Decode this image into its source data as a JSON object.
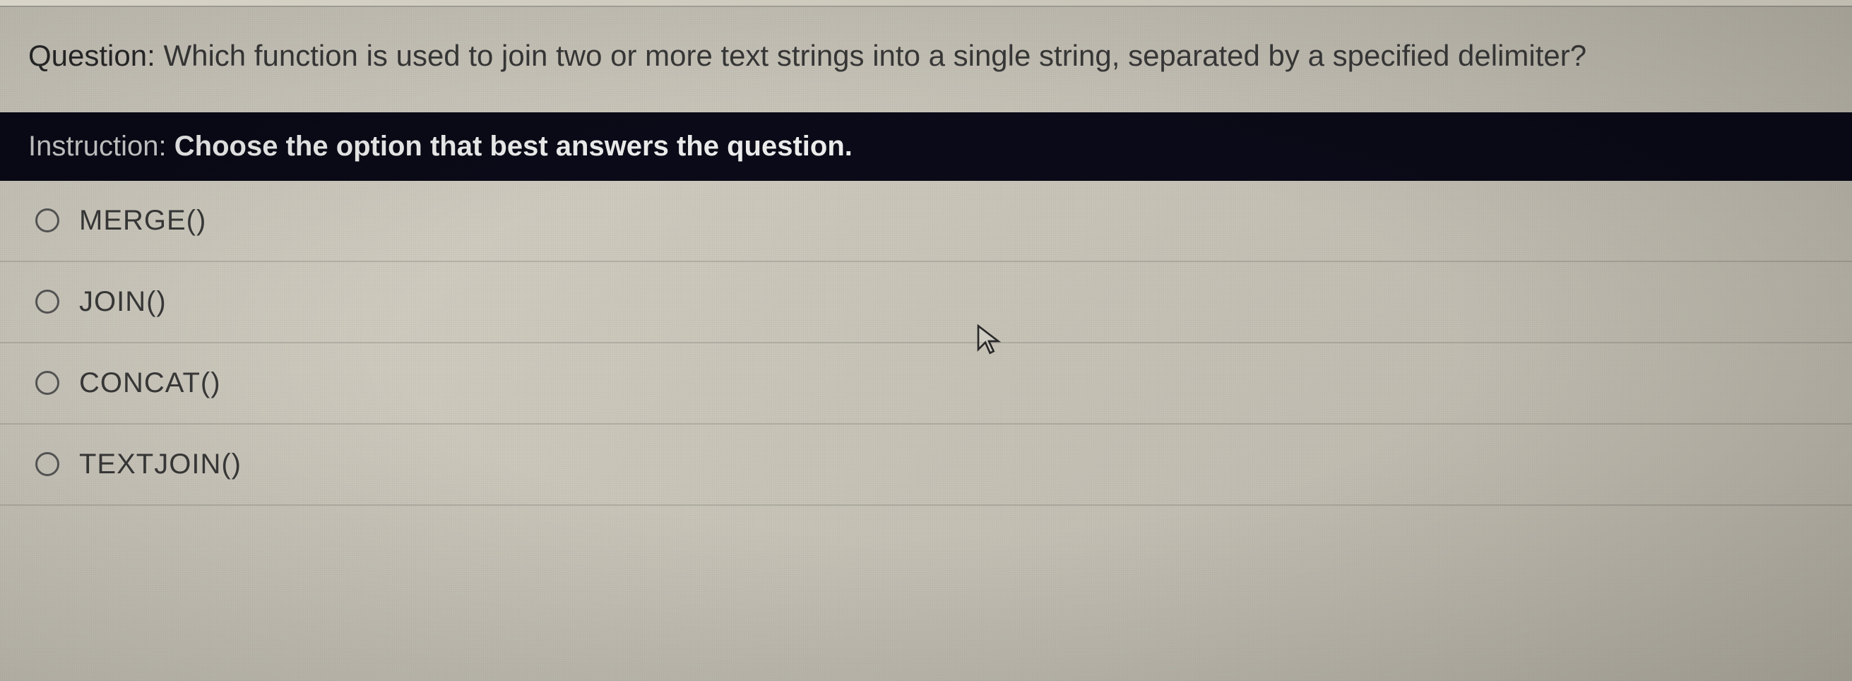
{
  "question": {
    "label": "Question:",
    "text": "Which function is used to join two or more text strings into a single string, separated by a specified delimiter?"
  },
  "instruction": {
    "label": "Instruction:",
    "text": "Choose the option that best answers the question."
  },
  "options": [
    {
      "label": "MERGE()"
    },
    {
      "label": "JOIN()"
    },
    {
      "label": "CONCAT()"
    },
    {
      "label": "TEXTJOIN()"
    }
  ]
}
